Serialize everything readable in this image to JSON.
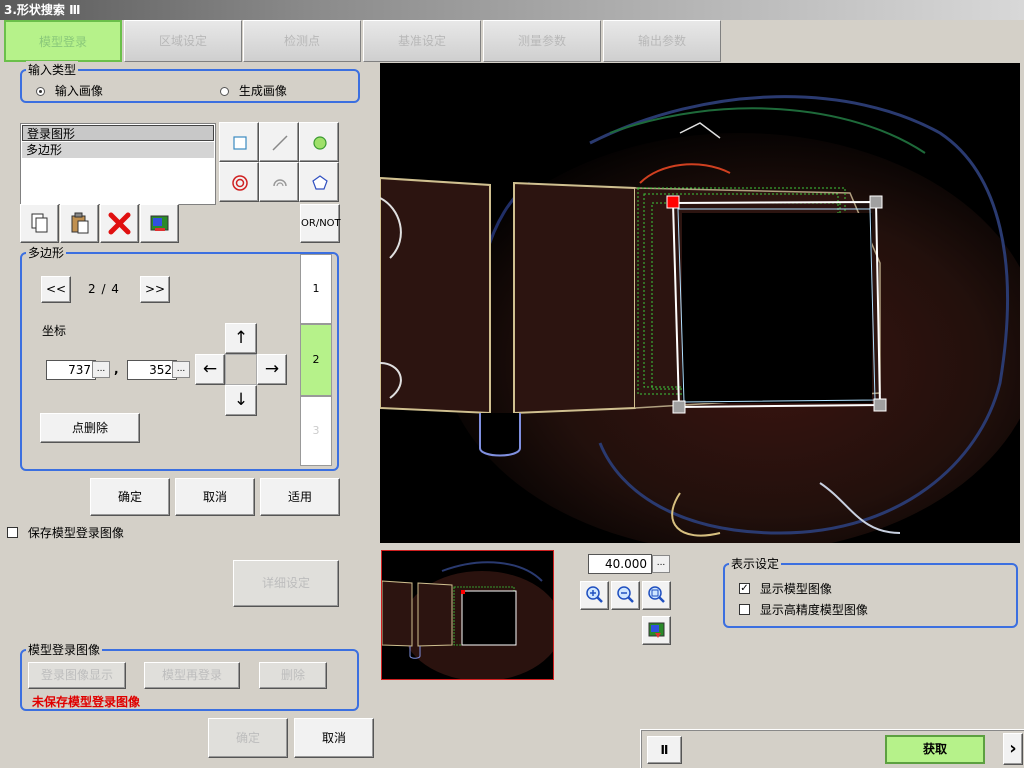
{
  "window": {
    "title": "3.形状搜索 Ⅲ"
  },
  "tabs": [
    {
      "label": "模型登录",
      "active": true
    },
    {
      "label": "区域设定"
    },
    {
      "label": "检测点"
    },
    {
      "label": "基准设定"
    },
    {
      "label": "测量参数"
    },
    {
      "label": "输出参数"
    }
  ],
  "input_type": {
    "legend": "输入类型",
    "options": [
      {
        "label": "输入画像",
        "selected": true
      },
      {
        "label": "生成画像",
        "selected": false
      }
    ]
  },
  "shape_list": {
    "items": [
      "登录图形",
      "多边形"
    ]
  },
  "shape_tools": {
    "icons": [
      "rectangle-tool-icon",
      "line-tool-icon",
      "circle-tool-icon",
      "ring-tool-icon",
      "arc-tool-icon",
      "polygon-tool-icon"
    ],
    "or_not_label": "OR/NOT"
  },
  "edit_tools": {
    "icons": [
      "copy-icon",
      "paste-icon",
      "delete-icon",
      "image-icon"
    ]
  },
  "polygon": {
    "legend": "多边形",
    "prev_label": "<<",
    "next_label": ">>",
    "page": "2 / 4",
    "coord_label": "坐标",
    "x": "737",
    "y": "352",
    "comma": ",",
    "dots_label": "...",
    "delete_point_label": "点删除",
    "arrows": {
      "up": "↑",
      "down": "↓",
      "left": "←",
      "right": "→"
    },
    "points": [
      {
        "label": "1",
        "selected": false
      },
      {
        "label": "2",
        "selected": true
      },
      {
        "label": "3",
        "selected": false,
        "disabled": true
      }
    ]
  },
  "actions": {
    "ok": "确定",
    "cancel": "取消",
    "apply": "适用"
  },
  "save_model": {
    "label": "保存模型登录图像",
    "checked": false
  },
  "detail_button": "详细设定",
  "model_image": {
    "legend": "模型登录图像",
    "show_label": "登录图像显示",
    "reregister_label": "模型再登录",
    "delete_label": "删除",
    "status": "未保存模型登录图像",
    "status_color": "#e00000"
  },
  "footer": {
    "ok": "确定",
    "cancel": "取消"
  },
  "zoom": {
    "value": "40.000",
    "dots": "..."
  },
  "zoom_icons": [
    "zoom-in-icon",
    "zoom-out-icon",
    "zoom-fit-icon",
    "image-save-icon"
  ],
  "display_settings": {
    "legend": "表示设定",
    "options": [
      {
        "label": "显示模型图像",
        "checked": true
      },
      {
        "label": "显示高精度模型图像",
        "checked": false
      }
    ]
  },
  "bottom_bar": {
    "pause_label": "Ⅱ",
    "acquire_label": "获取",
    "arrow": "›"
  },
  "colors": {
    "accent": "#3b6fe0",
    "active_tab": "#b6f28a",
    "point_selected": "#b6f28a",
    "acquire": "#b6f28a"
  }
}
